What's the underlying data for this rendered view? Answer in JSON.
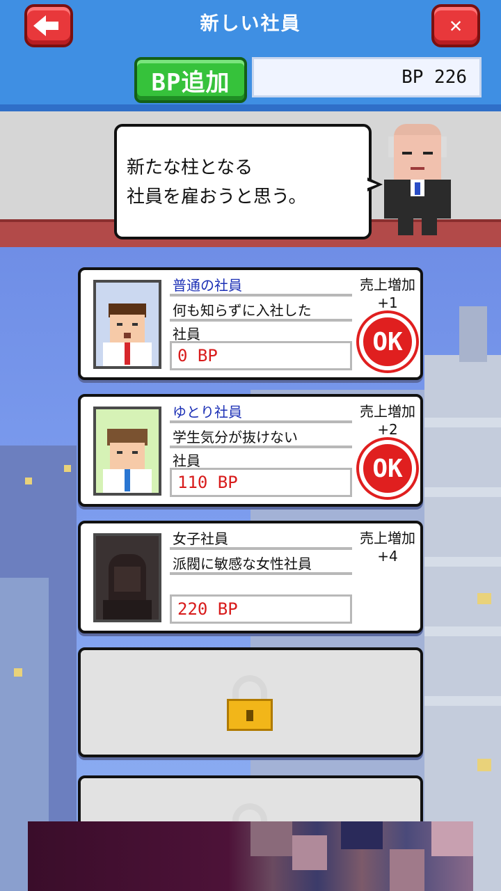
{
  "header": {
    "title": "新しい社員",
    "back_icon": "back-arrow-icon",
    "close_icon": "close-icon",
    "close_glyph": "✕",
    "bp_add_label": "BP追加",
    "bp_display": "BP 226"
  },
  "boss": {
    "speech_line1": "新たな柱となる",
    "speech_line2": "社員を雇おうと思う。"
  },
  "employees": [
    {
      "name": "普通の社員",
      "desc_line1": "何も知らずに入社した",
      "desc_line2": "社員",
      "price": "0 BP",
      "sales_label": "売上増加",
      "sales_value": "+1",
      "status": "OK"
    },
    {
      "name": "ゆとり社員",
      "desc_line1": "学生気分が抜けない",
      "desc_line2": "社員",
      "price": "110 BP",
      "sales_label": "売上増加",
      "sales_value": "+2",
      "status": "OK"
    },
    {
      "name": "女子社員",
      "desc_line1": "派閥に敏感な女性社員",
      "desc_line2": "",
      "price": "220 BP",
      "sales_label": "売上増加",
      "sales_value": "+4",
      "status": ""
    }
  ],
  "locked_slots": [
    "lock-icon",
    "lock-icon"
  ],
  "colors": {
    "header_blue": "#3f8fe3",
    "button_red": "#e8383b",
    "button_green": "#36c23b",
    "price_red": "#d81b1b",
    "name_blue": "#1b2fb5"
  }
}
